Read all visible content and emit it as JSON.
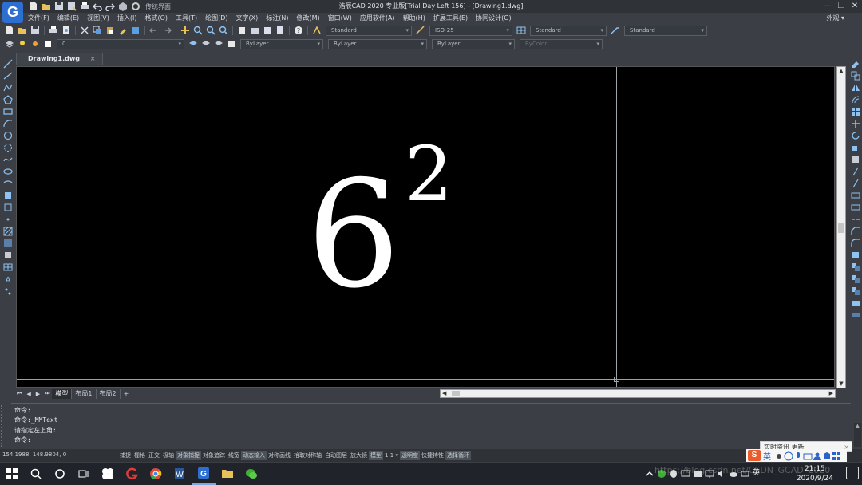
{
  "window": {
    "title": "浩辰CAD 2020 专业版[Trial Day Left 156] - [Drawing1.dwg]",
    "logo_letter": "G",
    "workspace": "传统界面",
    "controls": {
      "minimize": "—",
      "restore": "❐",
      "close": "✕"
    }
  },
  "menu": {
    "items": [
      "文件(F)",
      "编辑(E)",
      "视图(V)",
      "插入(I)",
      "格式(O)",
      "工具(T)",
      "绘图(D)",
      "文字(X)",
      "标注(N)",
      "修改(M)",
      "窗口(W)",
      "应用软件(A)",
      "帮助(H)",
      "扩展工具(E)",
      "协同设计(G)"
    ],
    "view_label": "外观 ▾"
  },
  "toolbar": {
    "text_style": "Standard",
    "dim_style": "ISO-25",
    "table_style": "Standard",
    "multileader_style": "Standard"
  },
  "layers": {
    "current_layer": "0",
    "color": "ByLayer",
    "linetype": "ByLayer",
    "lineweight": "ByLayer",
    "plot_style": "ByColor"
  },
  "document": {
    "tab_label": "Drawing1.dwg",
    "tab_close": "×"
  },
  "drawing": {
    "base": "6",
    "exponent": "2"
  },
  "layout_tabs": {
    "nav": [
      "⏮",
      "◀",
      "▶",
      "⏭"
    ],
    "tabs": [
      "模型",
      "布局1",
      "布局2"
    ],
    "add": "+"
  },
  "command": {
    "lines": [
      "命令:",
      "命令:_MMText",
      "请指定左上角:",
      "命令:"
    ]
  },
  "status": {
    "coords": "154.1988, 148.9804, 0",
    "items": [
      {
        "label": "捕捉",
        "on": false
      },
      {
        "label": "栅格",
        "on": false
      },
      {
        "label": "正交",
        "on": false
      },
      {
        "label": "极轴",
        "on": false
      },
      {
        "label": "对象捕捉",
        "on": true
      },
      {
        "label": "对象追踪",
        "on": false
      },
      {
        "label": "线宽",
        "on": false
      },
      {
        "label": "动态输入",
        "on": true
      },
      {
        "label": "对称画线",
        "on": false
      },
      {
        "label": "拾取对称轴",
        "on": false
      },
      {
        "label": "自动图层",
        "on": false
      },
      {
        "label": "放大镜",
        "on": false
      },
      {
        "label": "模型",
        "on": true
      },
      {
        "label": "1:1 ▾",
        "on": false
      },
      {
        "label": "透明度",
        "on": true
      },
      {
        "label": "快捷特性",
        "on": false
      },
      {
        "label": "选择循环",
        "on": true
      }
    ]
  },
  "ime": {
    "notice": "实时资讯 更新",
    "notice_close": "×",
    "logo": "S",
    "mode": "英"
  },
  "taskbar": {
    "time": "21:15",
    "date": "2020/9/24",
    "lang": "英"
  },
  "watermark": "https://blog.csdn.net/CSDN_GCAD_2020"
}
